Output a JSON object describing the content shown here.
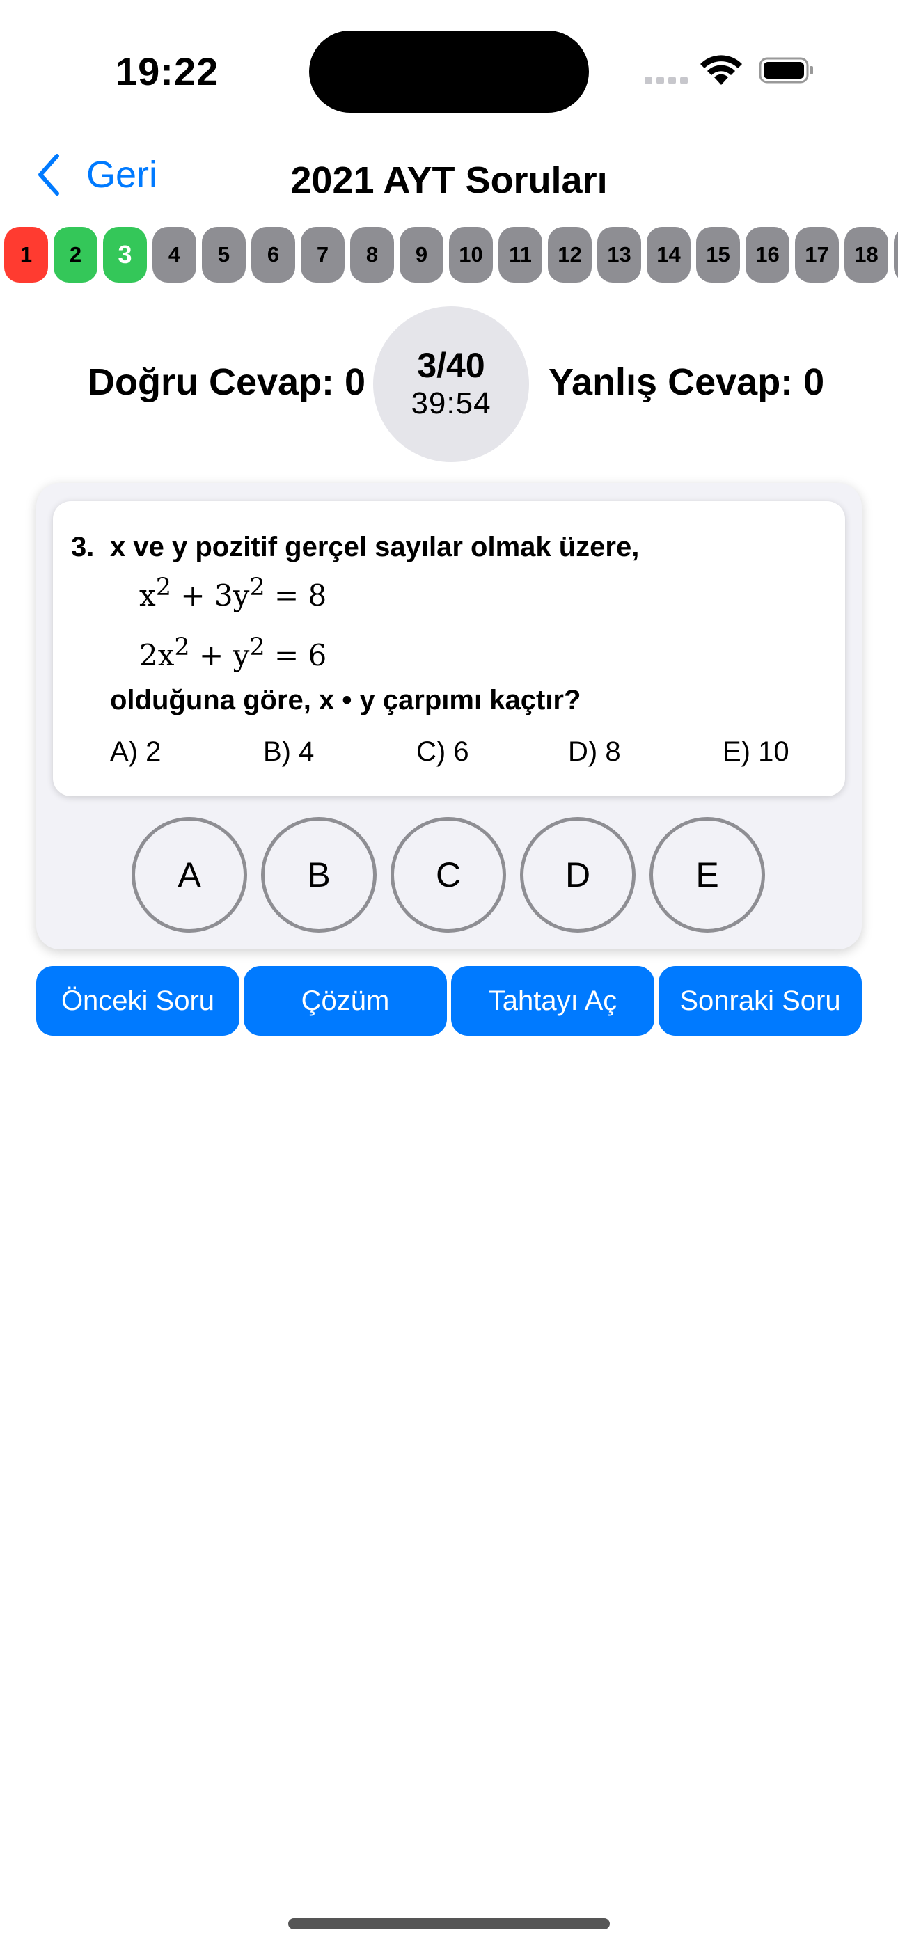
{
  "status_bar": {
    "time": "19:22",
    "icons": [
      "cellular-signal-icon",
      "wifi-icon",
      "battery-icon"
    ]
  },
  "nav": {
    "back_label": "Geri",
    "title": "2021 AYT Soruları"
  },
  "question_strip": {
    "chips": [
      {
        "label": "1",
        "state": "wrong"
      },
      {
        "label": "2",
        "state": "correct"
      },
      {
        "label": "3",
        "state": "correct-current"
      },
      {
        "label": "4",
        "state": "unanswered"
      },
      {
        "label": "5",
        "state": "unanswered"
      },
      {
        "label": "6",
        "state": "unanswered"
      },
      {
        "label": "7",
        "state": "unanswered"
      },
      {
        "label": "8",
        "state": "unanswered"
      },
      {
        "label": "9",
        "state": "unanswered"
      },
      {
        "label": "10",
        "state": "unanswered"
      },
      {
        "label": "11",
        "state": "unanswered"
      },
      {
        "label": "12",
        "state": "unanswered"
      },
      {
        "label": "13",
        "state": "unanswered"
      },
      {
        "label": "14",
        "state": "unanswered"
      },
      {
        "label": "15",
        "state": "unanswered"
      },
      {
        "label": "16",
        "state": "unanswered"
      },
      {
        "label": "17",
        "state": "unanswered"
      },
      {
        "label": "18",
        "state": "unanswered"
      },
      {
        "label": "",
        "state": "unanswered"
      }
    ],
    "colors": {
      "wrong": "#ff3b30",
      "correct": "#34c759",
      "unanswered": "#8e8e93"
    }
  },
  "score": {
    "correct_label": "Doğru Cevap: 0",
    "wrong_label": "Yanlış Cevap: 0",
    "progress": "3/40",
    "timer": "39:54"
  },
  "question": {
    "number": "3.",
    "stem": "x ve y pozitif gerçel sayılar olmak üzere,",
    "eq1": {
      "a": "x",
      "exp1": "2",
      "b": " + 3y",
      "exp2": "2",
      "c": " = 8"
    },
    "eq2": {
      "a": "2x",
      "exp1": "2",
      "b": " + y",
      "exp2": "2",
      "c": " = 6"
    },
    "ask": "olduğuna göre,  x • y  çarpımı kaçtır?",
    "options": [
      "A)  2",
      "B)  4",
      "C) 6",
      "D) 8",
      "E)  10"
    ]
  },
  "answers": [
    "A",
    "B",
    "C",
    "D",
    "E"
  ],
  "actions": {
    "prev": "Önceki Soru",
    "solution": "Çözüm",
    "board": "Tahtayı Aç",
    "next": "Sonraki Soru"
  },
  "accent_color": "#007aff"
}
